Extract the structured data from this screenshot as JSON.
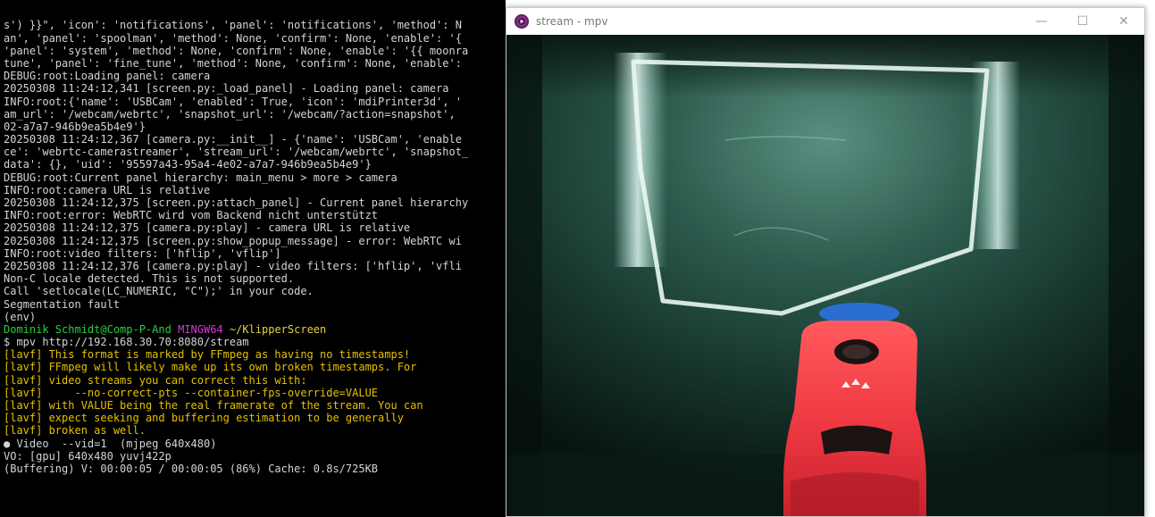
{
  "terminal": {
    "lines": [
      {
        "text": "s') }}\", 'icon': 'notifications', 'panel': 'notifications', 'method': N",
        "color": "white"
      },
      {
        "text": "an', 'panel': 'spoolman', 'method': None, 'confirm': None, 'enable': '{",
        "color": "white"
      },
      {
        "text": "'panel': 'system', 'method': None, 'confirm': None, 'enable': '{{ moonra",
        "color": "white"
      },
      {
        "text": "tune', 'panel': 'fine_tune', 'method': None, 'confirm': None, 'enable':",
        "color": "white"
      },
      {
        "text": "DEBUG:root:Loading panel: camera",
        "color": "white"
      },
      {
        "text": "20250308 11:24:12,341 [screen.py:_load_panel] - Loading panel: camera",
        "color": "white"
      },
      {
        "text": "INFO:root:{'name': 'USBCam', 'enabled': True, 'icon': 'mdiPrinter3d', '",
        "color": "white"
      },
      {
        "text": "am_url': '/webcam/webrtc', 'snapshot_url': '/webcam/?action=snapshot',",
        "color": "white"
      },
      {
        "text": "02-a7a7-946b9ea5b4e9'}",
        "color": "white"
      },
      {
        "text": "20250308 11:24:12,367 [camera.py:__init__] - {'name': 'USBCam', 'enable",
        "color": "white"
      },
      {
        "text": "ce': 'webrtc-camerastreamer', 'stream_url': '/webcam/webrtc', 'snapshot_",
        "color": "white"
      },
      {
        "text": "data': {}, 'uid': '95597a43-95a4-4e02-a7a7-946b9ea5b4e9'}",
        "color": "white"
      },
      {
        "text": "DEBUG:root:Current panel hierarchy: main_menu > more > camera",
        "color": "white"
      },
      {
        "text": "INFO:root:camera URL is relative",
        "color": "white"
      },
      {
        "text": "20250308 11:24:12,375 [screen.py:attach_panel] - Current panel hierarchy",
        "color": "white"
      },
      {
        "text": "INFO:root:error: WebRTC wird vom Backend nicht unterstützt",
        "color": "white"
      },
      {
        "text": "20250308 11:24:12,375 [camera.py:play] - camera URL is relative",
        "color": "white"
      },
      {
        "text": "20250308 11:24:12,375 [screen.py:show_popup_message] - error: WebRTC wi",
        "color": "white"
      },
      {
        "text": "INFO:root:video filters: ['hflip', 'vflip']",
        "color": "white"
      },
      {
        "text": "20250308 11:24:12,376 [camera.py:play] - video filters: ['hflip', 'vfli",
        "color": "white"
      },
      {
        "text": "Non-C locale detected. This is not supported.",
        "color": "white"
      },
      {
        "text": "Call 'setlocale(LC_NUMERIC, \"C\");' in your code.",
        "color": "white"
      },
      {
        "text": "Segmentation fault",
        "color": "white"
      },
      {
        "text": "(env)",
        "color": "white"
      },
      {
        "text": "",
        "color": "prompt"
      },
      {
        "text": "$ mpv http://192.168.30.70:8080/stream",
        "color": "white"
      },
      {
        "text": "[lavf] This format is marked by FFmpeg as having no timestamps!",
        "color": "warn"
      },
      {
        "text": "[lavf] FFmpeg will likely make up its own broken timestamps. For",
        "color": "warn"
      },
      {
        "text": "[lavf] video streams you can correct this with:",
        "color": "warn"
      },
      {
        "text": "[lavf]     --no-correct-pts --container-fps-override=VALUE",
        "color": "warn"
      },
      {
        "text": "[lavf] with VALUE being the real framerate of the stream. You can",
        "color": "warn"
      },
      {
        "text": "[lavf] expect seeking and buffering estimation to be generally",
        "color": "warn"
      },
      {
        "text": "[lavf] broken as well.",
        "color": "warn"
      },
      {
        "text": "● Video  --vid=1  (mjpeg 640x480)",
        "color": "white"
      },
      {
        "text": "VO: [gpu] 640x480 yuvj422p",
        "color": "white"
      },
      {
        "text": "(Buffering) V: 00:00:05 / 00:00:05 (86%) Cache: 0.8s/725KB",
        "color": "white"
      }
    ],
    "prompt": {
      "user_host": "Dominik Schmidt@Comp-P-And",
      "shell": "MINGW64",
      "path": "~/KlipperScreen"
    }
  },
  "mpv": {
    "title": "stream - mpv",
    "controls": {
      "minimize": "—",
      "maximize": "☐",
      "close": "✕"
    },
    "accent_color": "#691f69"
  },
  "colors": {
    "terminal_bg": "#000000",
    "warn": "#e5c100",
    "prompt_green": "#2ecc40",
    "prompt_magenta": "#d33bd3",
    "prompt_yellow": "#e8d23a"
  }
}
